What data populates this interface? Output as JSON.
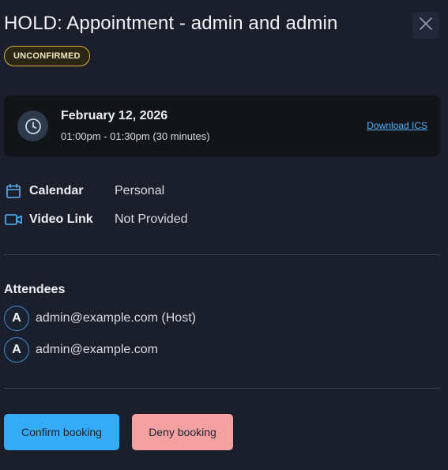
{
  "modal": {
    "title": "HOLD: Appointment - admin and admin",
    "status_badge": "UNCONFIRMED",
    "close_icon": "close-icon"
  },
  "schedule": {
    "icon": "clock-icon",
    "date": "February 12, 2026",
    "time_range": "01:00pm - 01:30pm (30 minutes)",
    "download_label": "Download ICS"
  },
  "details": {
    "calendar": {
      "icon": "calendar-icon",
      "label": "Calendar",
      "value": "Personal"
    },
    "video": {
      "icon": "video-camera-icon",
      "label": "Video Link",
      "value": "Not Provided"
    }
  },
  "attendees": {
    "title": "Attendees",
    "items": [
      {
        "initial": "A",
        "email": "admin@example.com (Host)"
      },
      {
        "initial": "A",
        "email": "admin@example.com"
      }
    ]
  },
  "actions": {
    "confirm_label": "Confirm booking",
    "deny_label": "Deny booking"
  },
  "colors": {
    "background": "#1b1f2b",
    "card": "#131418",
    "accent_blue": "#35aaf7",
    "link_blue": "#4fb3ff",
    "deny_pink": "#f6a1a1",
    "badge_border": "#d7b236"
  }
}
